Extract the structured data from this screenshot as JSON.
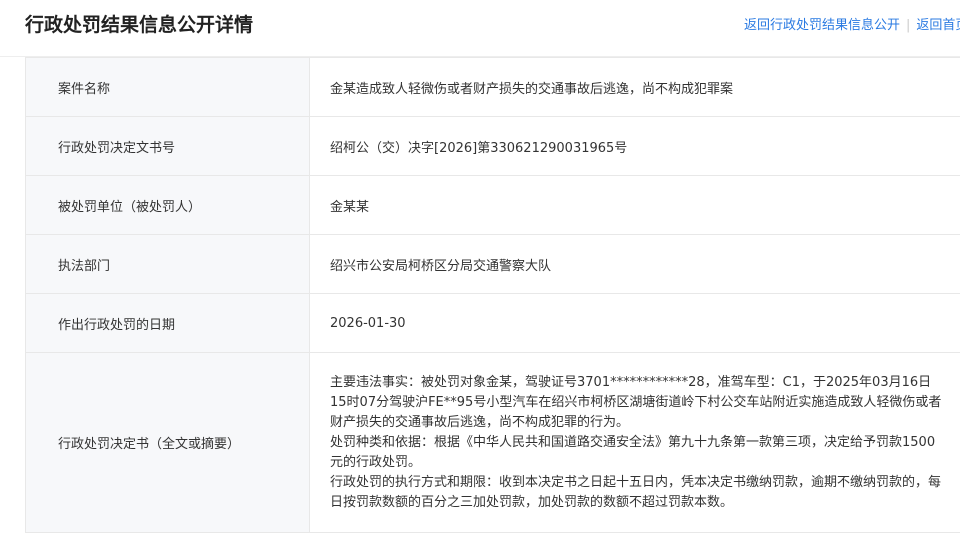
{
  "header": {
    "title": "行政处罚结果信息公开详情",
    "link_back_list": "返回行政处罚结果信息公开",
    "link_home": "返回首页"
  },
  "rows": [
    {
      "label": "案件名称",
      "value": "金某造成致人轻微伤或者财产损失的交通事故后逃逸，尚不构成犯罪案"
    },
    {
      "label": "行政处罚决定文书号",
      "value": "绍柯公（交）决字[2026]第330621290031965号"
    },
    {
      "label": "被处罚单位（被处罚人）",
      "value": "金某某"
    },
    {
      "label": "执法部门",
      "value": "绍兴市公安局柯桥区分局交通警察大队"
    },
    {
      "label": "作出行政处罚的日期",
      "value": "2026-01-30"
    }
  ],
  "decision": {
    "label": "行政处罚决定书（全文或摘要）",
    "paragraphs": [
      "主要违法事实：被处罚对象金某，驾驶证号3701************28，准驾车型：C1，于2025年03月16日15时07分驾驶沪FE**95号小型汽车在绍兴市柯桥区湖塘街道岭下村公交车站附近实施造成致人轻微伤或者财产损失的交通事故后逃逸，尚不构成犯罪的行为。",
      "处罚种类和依据：根据《中华人民共和国道路交通安全法》第九十九条第一款第三项，决定给予罚款1500元的行政处罚。",
      "行政处罚的执行方式和期限：收到本决定书之日起十五日内，凭本决定书缴纳罚款，逾期不缴纳罚款的，每日按罚款数额的百分之三加处罚款，加处罚款的数额不超过罚款本数。"
    ]
  }
}
